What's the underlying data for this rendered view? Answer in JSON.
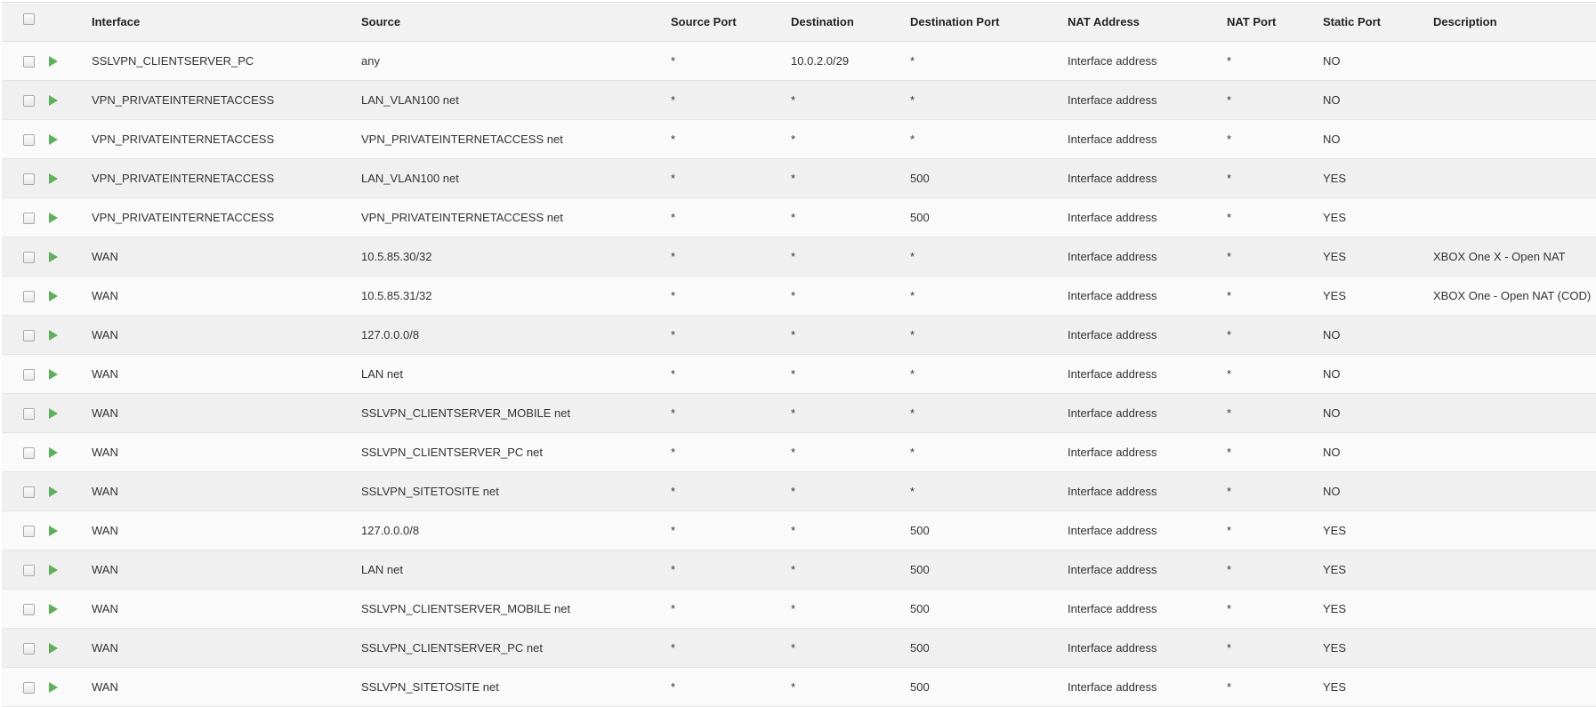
{
  "columns": {
    "interface": "Interface",
    "source": "Source",
    "source_port": "Source Port",
    "destination": "Destination",
    "destination_port": "Destination Port",
    "nat_address": "NAT Address",
    "nat_port": "NAT Port",
    "static_port": "Static Port",
    "description": "Description"
  },
  "icons": {
    "enabled": "play-icon",
    "enabled_color": "#5fb05a"
  },
  "rows": [
    {
      "interface": "SSLVPN_CLIENTSERVER_PC",
      "source": "any",
      "source_port": "*",
      "destination": "10.0.2.0/29",
      "destination_port": "*",
      "nat_address": "Interface address",
      "nat_port": "*",
      "static_port": "NO",
      "description": ""
    },
    {
      "interface": "VPN_PRIVATEINTERNETACCESS",
      "source": "LAN_VLAN100 net",
      "source_port": "*",
      "destination": "*",
      "destination_port": "*",
      "nat_address": "Interface address",
      "nat_port": "*",
      "static_port": "NO",
      "description": ""
    },
    {
      "interface": "VPN_PRIVATEINTERNETACCESS",
      "source": "VPN_PRIVATEINTERNETACCESS net",
      "source_port": "*",
      "destination": "*",
      "destination_port": "*",
      "nat_address": "Interface address",
      "nat_port": "*",
      "static_port": "NO",
      "description": ""
    },
    {
      "interface": "VPN_PRIVATEINTERNETACCESS",
      "source": "LAN_VLAN100 net",
      "source_port": "*",
      "destination": "*",
      "destination_port": "500",
      "nat_address": "Interface address",
      "nat_port": "*",
      "static_port": "YES",
      "description": ""
    },
    {
      "interface": "VPN_PRIVATEINTERNETACCESS",
      "source": "VPN_PRIVATEINTERNETACCESS net",
      "source_port": "*",
      "destination": "*",
      "destination_port": "500",
      "nat_address": "Interface address",
      "nat_port": "*",
      "static_port": "YES",
      "description": ""
    },
    {
      "interface": "WAN",
      "source": "10.5.85.30/32",
      "source_port": "*",
      "destination": "*",
      "destination_port": "*",
      "nat_address": "Interface address",
      "nat_port": "*",
      "static_port": "YES",
      "description": "XBOX One X - Open NAT"
    },
    {
      "interface": "WAN",
      "source": "10.5.85.31/32",
      "source_port": "*",
      "destination": "*",
      "destination_port": "*",
      "nat_address": "Interface address",
      "nat_port": "*",
      "static_port": "YES",
      "description": "XBOX One - Open NAT (COD)"
    },
    {
      "interface": "WAN",
      "source": "127.0.0.0/8",
      "source_port": "*",
      "destination": "*",
      "destination_port": "*",
      "nat_address": "Interface address",
      "nat_port": "*",
      "static_port": "NO",
      "description": ""
    },
    {
      "interface": "WAN",
      "source": "LAN net",
      "source_port": "*",
      "destination": "*",
      "destination_port": "*",
      "nat_address": "Interface address",
      "nat_port": "*",
      "static_port": "NO",
      "description": ""
    },
    {
      "interface": "WAN",
      "source": "SSLVPN_CLIENTSERVER_MOBILE net",
      "source_port": "*",
      "destination": "*",
      "destination_port": "*",
      "nat_address": "Interface address",
      "nat_port": "*",
      "static_port": "NO",
      "description": ""
    },
    {
      "interface": "WAN",
      "source": "SSLVPN_CLIENTSERVER_PC net",
      "source_port": "*",
      "destination": "*",
      "destination_port": "*",
      "nat_address": "Interface address",
      "nat_port": "*",
      "static_port": "NO",
      "description": ""
    },
    {
      "interface": "WAN",
      "source": "SSLVPN_SITETOSITE net",
      "source_port": "*",
      "destination": "*",
      "destination_port": "*",
      "nat_address": "Interface address",
      "nat_port": "*",
      "static_port": "NO",
      "description": ""
    },
    {
      "interface": "WAN",
      "source": "127.0.0.0/8",
      "source_port": "*",
      "destination": "*",
      "destination_port": "500",
      "nat_address": "Interface address",
      "nat_port": "*",
      "static_port": "YES",
      "description": ""
    },
    {
      "interface": "WAN",
      "source": "LAN net",
      "source_port": "*",
      "destination": "*",
      "destination_port": "500",
      "nat_address": "Interface address",
      "nat_port": "*",
      "static_port": "YES",
      "description": ""
    },
    {
      "interface": "WAN",
      "source": "SSLVPN_CLIENTSERVER_MOBILE net",
      "source_port": "*",
      "destination": "*",
      "destination_port": "500",
      "nat_address": "Interface address",
      "nat_port": "*",
      "static_port": "YES",
      "description": ""
    },
    {
      "interface": "WAN",
      "source": "SSLVPN_CLIENTSERVER_PC net",
      "source_port": "*",
      "destination": "*",
      "destination_port": "500",
      "nat_address": "Interface address",
      "nat_port": "*",
      "static_port": "YES",
      "description": ""
    },
    {
      "interface": "WAN",
      "source": "SSLVPN_SITETOSITE net",
      "source_port": "*",
      "destination": "*",
      "destination_port": "500",
      "nat_address": "Interface address",
      "nat_port": "*",
      "static_port": "YES",
      "description": ""
    }
  ]
}
